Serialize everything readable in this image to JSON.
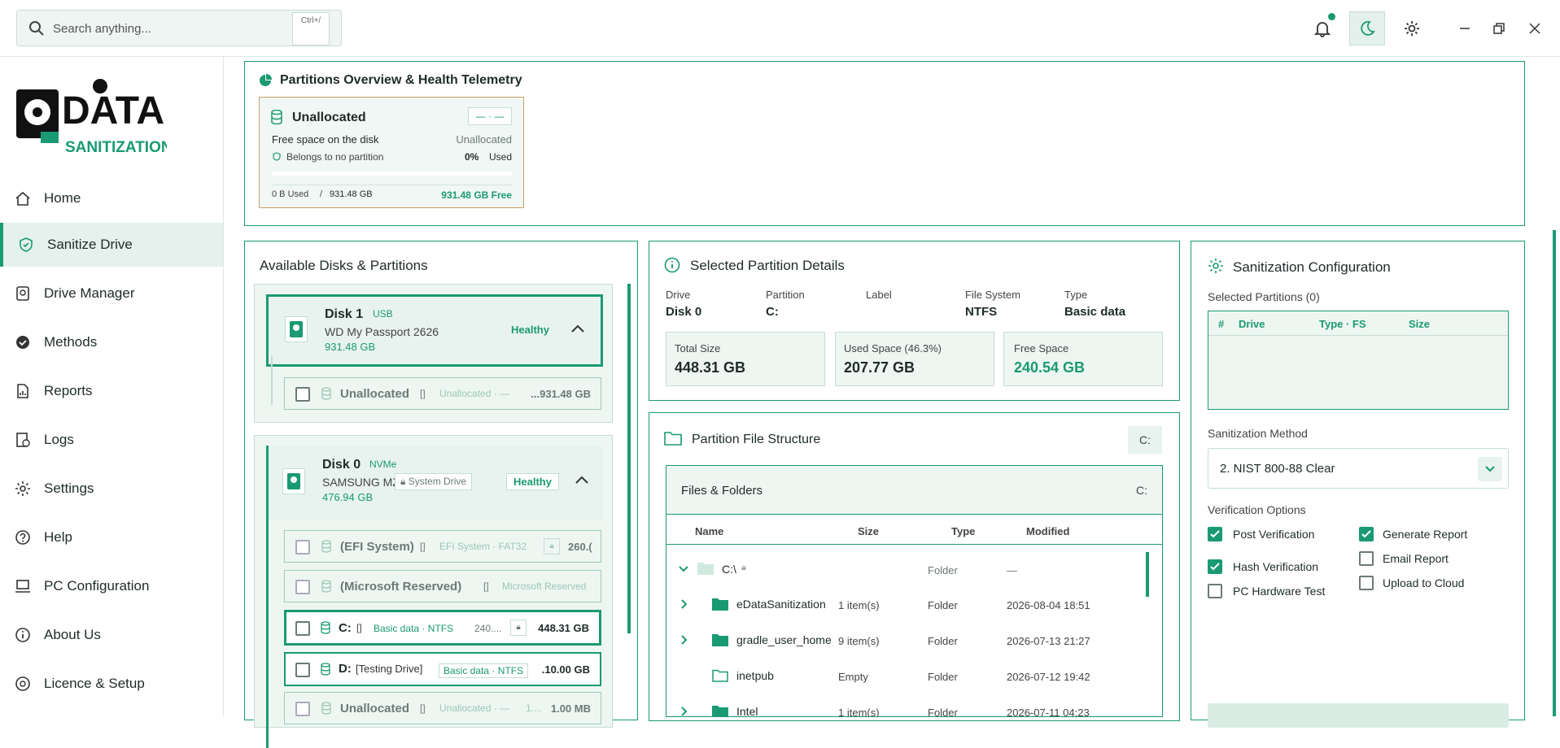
{
  "search": {
    "placeholder": "Search anything...",
    "shortcut": "Ctrl+/"
  },
  "icons": {
    "bell": "bell-icon",
    "moon": "moon-icon",
    "gear": "gear-icon",
    "minimize": "minimize-icon",
    "restore": "restore-icon",
    "close": "close-icon"
  },
  "brand": {
    "logo_text": "DATA SANITIZATION"
  },
  "nav": [
    {
      "label": "Home",
      "icon": "home-icon"
    },
    {
      "label": "Sanitize Drive",
      "icon": "shield-icon"
    },
    {
      "label": "Drive Manager",
      "icon": "drive-icon"
    },
    {
      "label": "Methods",
      "icon": "badge-icon"
    },
    {
      "label": "Reports",
      "icon": "report-icon"
    },
    {
      "label": "Logs",
      "icon": "logs-icon"
    },
    {
      "label": "Settings",
      "icon": "settings-icon"
    },
    {
      "label": "Help",
      "icon": "help-icon"
    },
    {
      "label": "PC Configuration",
      "icon": "pc-icon"
    },
    {
      "label": "About Us",
      "icon": "info-icon"
    },
    {
      "label": "Licence & Setup",
      "icon": "license-icon"
    }
  ],
  "overview": {
    "title": "Partitions Overview & Health Telemetry",
    "card": {
      "name": "Unallocated",
      "badge": "— · —",
      "desc": "Free space on the disk",
      "type": "Unallocated",
      "note": "Belongs to no partition",
      "pct": "0%",
      "used_word": "Used",
      "used": "0 B Used",
      "sep": "/",
      "total": "931.48 GB",
      "free": "931.48 GB Free",
      "used_fraction": 0
    }
  },
  "disks": {
    "title": "Available Disks & Partitions",
    "disk1": {
      "name": "Disk 1",
      "bus": "USB",
      "model": "WD My Passport 2626",
      "size": "931.48 GB",
      "health": "Healthy",
      "parts": [
        {
          "name": "Unallocated",
          "bracket": "[]",
          "meta": "Unallocated · —",
          "size": "...931.48 GB"
        }
      ]
    },
    "disk0": {
      "name": "Disk 0",
      "bus": "NVMe",
      "model": "SAMSUNG MZ...",
      "sys": "System Drive",
      "size": "476.94 GB",
      "health": "Healthy",
      "parts": [
        {
          "name": "(EFI System)",
          "bracket": "[]",
          "meta": "EFI System · FAT32",
          "size": "260.("
        },
        {
          "name": "(Microsoft Reserved)",
          "bracket": "[]",
          "meta": "Microsoft Reserved",
          "size": ""
        },
        {
          "name": "C:",
          "bracket": "[]",
          "meta": "Basic data · NTFS",
          "extra": "240....",
          "size": "448.31 GB"
        },
        {
          "name": "D:",
          "bracket": "[Testing Drive]",
          "meta": "Basic data · NTFS",
          "size": ".10.00 GB"
        },
        {
          "name": "Unallocated",
          "bracket": "[]",
          "meta": "Unallocated · —",
          "extra": "1....",
          "size": "1.00 MB"
        }
      ]
    }
  },
  "details": {
    "title": "Selected Partition Details",
    "cols": [
      {
        "k": "Drive",
        "v": "Disk 0"
      },
      {
        "k": "Partition",
        "v": "C:"
      },
      {
        "k": "Label",
        "v": ""
      },
      {
        "k": "File System",
        "v": "NTFS"
      },
      {
        "k": "Type",
        "v": "Basic data"
      }
    ],
    "total_k": "Total Size",
    "total_v": "448.31 GB",
    "used_k": "Used Space (46.3%)",
    "used_v": "207.77 GB",
    "free_k": "Free Space",
    "free_v": "240.54 GB"
  },
  "files": {
    "title": "Partition File Structure",
    "drive": "C:",
    "sub": "Files & Folders",
    "sub_drive": "C:",
    "headers": {
      "name": "Name",
      "size": "Size",
      "type": "Type",
      "modified": "Modified"
    },
    "root": {
      "name": "C:\\",
      "type": "Folder",
      "modified": "—"
    },
    "rows": [
      {
        "name": "eDataSanitization",
        "size": "1 item(s)",
        "type": "Folder",
        "modified": "2026-08-04 18:51",
        "exp": true
      },
      {
        "name": "gradle_user_home",
        "size": "9 item(s)",
        "type": "Folder",
        "modified": "2026-07-13 21:27",
        "exp": true
      },
      {
        "name": "inetpub",
        "size": "Empty",
        "type": "Folder",
        "modified": "2026-07-12 19:42",
        "exp": false
      },
      {
        "name": "Intel",
        "size": "1 item(s)",
        "type": "Folder",
        "modified": "2026-07-11 04:23",
        "exp": true
      }
    ]
  },
  "config": {
    "title": "Sanitization Configuration",
    "selected": "Selected Partitions (0)",
    "headers": {
      "num": "#",
      "drive": "Drive",
      "type": "Type · FS",
      "size": "Size"
    },
    "method_label": "Sanitization Method",
    "method_value": "2. NIST 800-88 Clear",
    "verify_label": "Verification Options",
    "options": [
      {
        "label": "Post Verification",
        "on": true
      },
      {
        "label": "Generate Report",
        "on": true
      },
      {
        "label": "Email Report",
        "on": false
      },
      {
        "label": "Hash Verification",
        "on": true
      },
      {
        "label": "Upload to Cloud",
        "on": false
      },
      {
        "label": "PC Hardware Test",
        "on": false
      }
    ]
  },
  "colors": {
    "accent": "#1a9a72",
    "card_border": "#c9a060"
  }
}
